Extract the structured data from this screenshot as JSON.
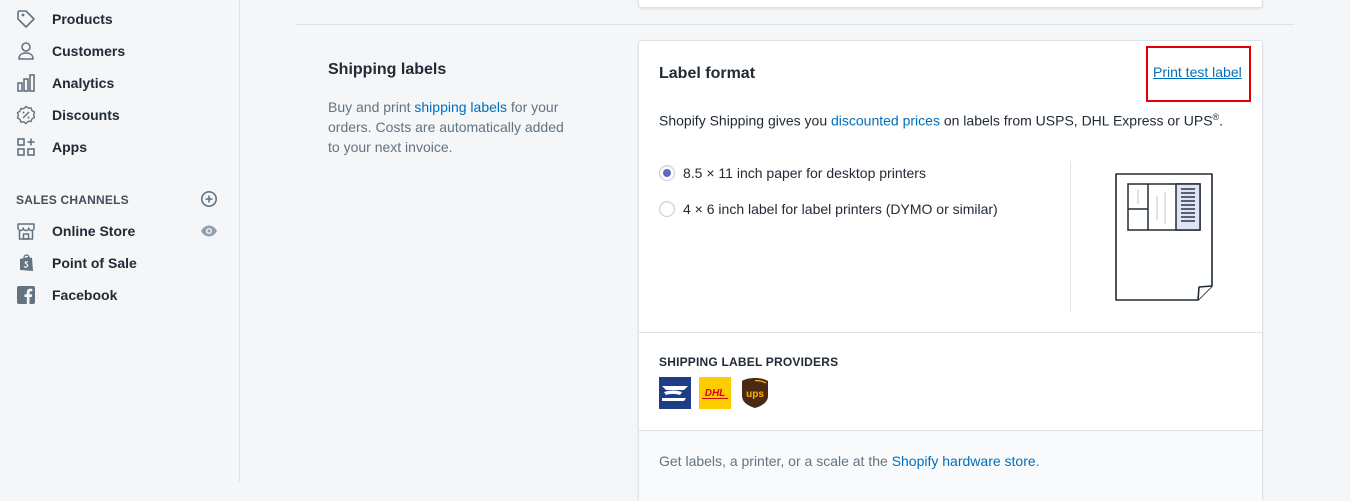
{
  "sidebar": {
    "items": [
      {
        "label": "Products",
        "icon": "tag-icon"
      },
      {
        "label": "Customers",
        "icon": "person-icon"
      },
      {
        "label": "Analytics",
        "icon": "bar-chart-icon"
      },
      {
        "label": "Discounts",
        "icon": "discount-icon"
      },
      {
        "label": "Apps",
        "icon": "apps-icon"
      }
    ],
    "sales_channels_heading": "SALES CHANNELS",
    "channels": [
      {
        "label": "Online Store",
        "icon": "store-icon"
      },
      {
        "label": "Point of Sale",
        "icon": "shopify-bag-icon"
      },
      {
        "label": "Facebook",
        "icon": "facebook-icon"
      }
    ]
  },
  "section": {
    "title": "Shipping labels",
    "desc_before": "Buy and print ",
    "desc_link": "shipping labels",
    "desc_after": " for your orders. Costs are automatically added to your next invoice."
  },
  "card": {
    "title": "Label format",
    "print_test_label": "Print test label",
    "intro_before": "Shopify Shipping gives you ",
    "intro_link": "discounted prices",
    "intro_after": " on labels from USPS, DHL Express or UPS",
    "intro_sup": "®",
    "intro_end": ".",
    "options": [
      {
        "label": "8.5 × 11 inch paper for desktop printers",
        "checked": true
      },
      {
        "label": "4 × 6 inch label for label printers (DYMO or similar)",
        "checked": false
      }
    ],
    "providers_heading": "SHIPPING LABEL PROVIDERS",
    "providers": [
      "USPS",
      "DHL",
      "UPS"
    ],
    "footer_before": "Get labels, a printer, or a scale at the ",
    "footer_link": "Shopify hardware store",
    "footer_after": "."
  },
  "colors": {
    "accent": "#5c6ac4",
    "link": "#006fbb",
    "highlight_box": "#e00000",
    "usps_blue": "#1e3f86",
    "dhl_yellow": "#ffcc00",
    "dhl_red": "#d40511",
    "ups_brown": "#4a2a14",
    "ups_gold": "#ffb500"
  }
}
